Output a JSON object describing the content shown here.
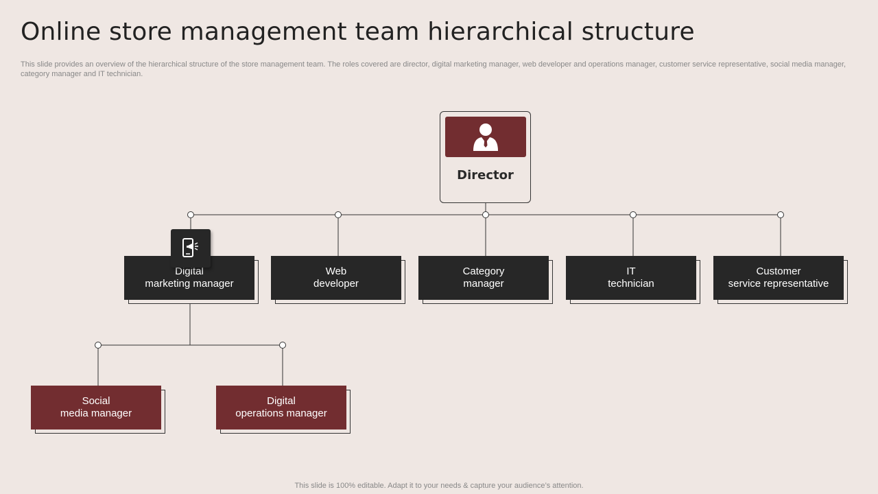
{
  "slide": {
    "title": "Online store management team hierarchical structure",
    "description": "This slide provides an overview of the hierarchical structure of the store management team. The roles covered are director, digital marketing manager, web developer and operations manager, customer service representative, social media manager, category manager and IT technician.",
    "footer": "This slide is 100% editable. Adapt it to your needs & capture your audience’s attention."
  },
  "director": {
    "label": "Director",
    "icon": "person-icon"
  },
  "level1": [
    {
      "key": "digital-marketing",
      "label": "Digital\nmarketing manager"
    },
    {
      "key": "web-developer",
      "label": "Web\ndeveloper"
    },
    {
      "key": "category-manager",
      "label": "Category\nmanager"
    },
    {
      "key": "it-technician",
      "label": "IT\ntechnician"
    },
    {
      "key": "customer-service",
      "label": "Customer\nservice representative"
    }
  ],
  "level2": [
    {
      "key": "social-media",
      "label": "Social\nmedia manager"
    },
    {
      "key": "digital-operations",
      "label": "Digital\noperations manager"
    }
  ],
  "marketing_badge_icon": "mobile-megaphone-icon",
  "colors": {
    "background": "#efe7e3",
    "accent": "#722d30",
    "dark": "#272727"
  }
}
